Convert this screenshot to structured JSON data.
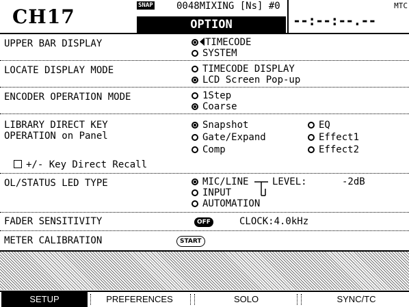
{
  "header": {
    "channel": "CH17",
    "snap_badge": "SNAP",
    "scene_text": "0048MIXING [Ns]   #0",
    "title": "OPTION",
    "mtc_label": "MTC",
    "timecode": "--:--:--.--"
  },
  "upper_bar": {
    "label": "UPPER BAR DISPLAY",
    "options": [
      "TIMECODE",
      "SYSTEM"
    ],
    "selected": "TIMECODE"
  },
  "locate": {
    "label": "LOCATE DISPLAY MODE",
    "options": [
      "TIMECODE DISPLAY",
      "LCD Screen Pop-up"
    ],
    "selected": "LCD Screen Pop-up"
  },
  "encoder": {
    "label": "ENCODER OPERATION MODE",
    "options": [
      "1Step",
      "Coarse"
    ],
    "selected": "Coarse"
  },
  "library": {
    "label_line1": "LIBRARY DIRECT KEY",
    "label_line2": "OPERATION on Panel",
    "options": [
      "Snapshot",
      "Gate/Expand",
      "Comp",
      "EQ",
      "Effect1",
      "Effect2"
    ],
    "selected": "Snapshot",
    "checkbox_label": "+/- Key Direct Recall"
  },
  "ol_status": {
    "label": "OL/STATUS LED TYPE",
    "options": [
      "MIC/LINE",
      "INPUT",
      "AUTOMATION"
    ],
    "selected": "MIC/LINE",
    "level_label": "LEVEL:",
    "level_value": "-2dB"
  },
  "fader": {
    "label": "FADER SENSITIVITY",
    "toggle_label": "OFF",
    "clock_text": "CLOCK:4.0kHz"
  },
  "meter": {
    "label": "METER CALIBRATION",
    "start_label": "START"
  },
  "tabs": [
    {
      "label": "SETUP"
    },
    {
      "label": "PREFERENCES"
    },
    {
      "label": "SOLO"
    },
    {
      "label": "SYNC/TC"
    }
  ]
}
